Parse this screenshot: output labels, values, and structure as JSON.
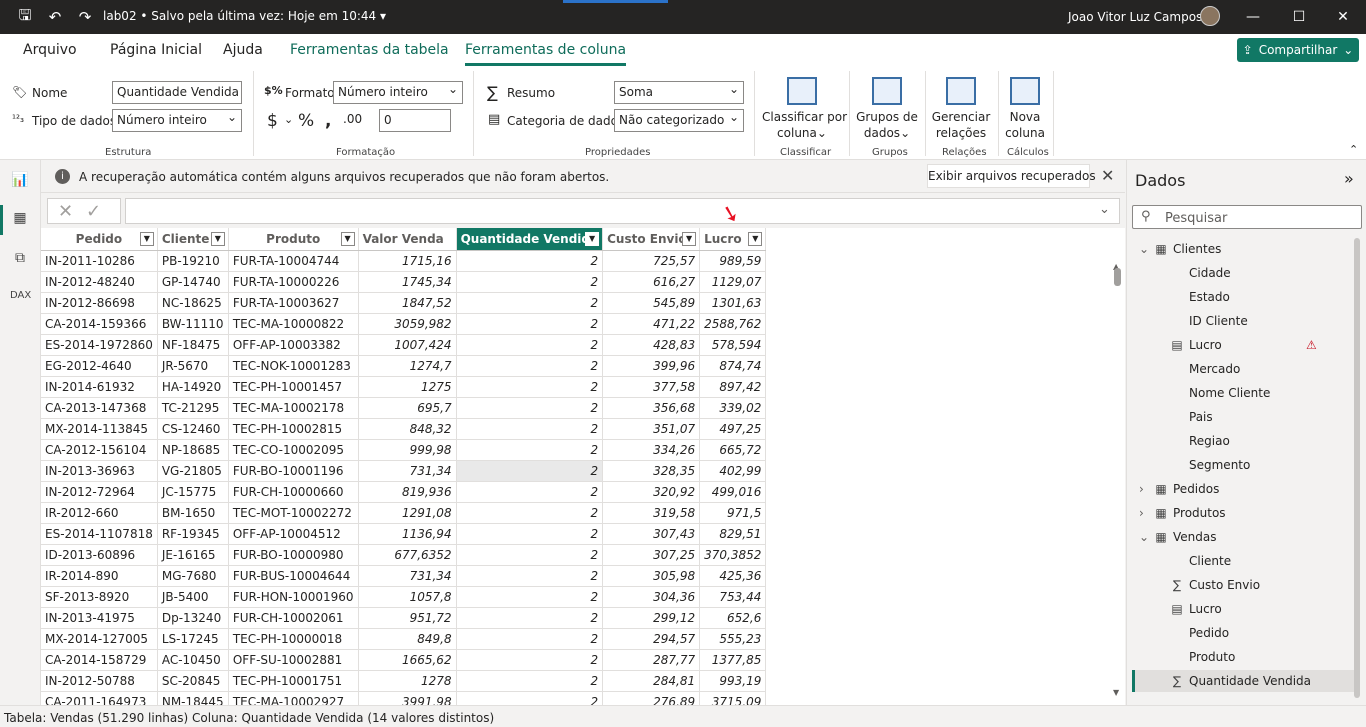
{
  "titlebar": {
    "title": "lab02 • Salvo pela última vez: Hoje em 10:44 ▾",
    "user": "Joao Vitor Luz Campos"
  },
  "tabs": {
    "arquivo": "Arquivo",
    "pagina_inicial": "Página Inicial",
    "ajuda": "Ajuda",
    "ferramentas_tabela": "Ferramentas da tabela",
    "ferramentas_coluna": "Ferramentas de coluna",
    "compartilhar": "Compartilhar"
  },
  "ribbon": {
    "nome_label": "Nome",
    "nome_value": "Quantidade Vendida",
    "tipo_label": "Tipo de dados",
    "tipo_value": "Número inteiro",
    "estrutura": "Estrutura",
    "formato_label": "Formato",
    "formato_value": "Número inteiro",
    "decimal_value": "0",
    "formatacao": "Formatação",
    "resumo_label": "Resumo",
    "resumo_value": "Soma",
    "categoria_label": "Categoria de dados",
    "categoria_value": "Não categorizado",
    "propriedades": "Propriedades",
    "classificar_btn": "Classificar por",
    "classificar_btn2": "coluna",
    "classificar": "Classificar",
    "grupos_btn": "Grupos de",
    "grupos_btn2": "dados",
    "grupos": "Grupos",
    "gerenciar_btn": "Gerenciar",
    "gerenciar_btn2": "relações",
    "relacoes": "Relações",
    "nova_btn": "Nova",
    "nova_btn2": "coluna",
    "calculos": "Cálculos"
  },
  "infobar": {
    "message": "A recuperação automática contém alguns arquivos recuperados que não foram abertos.",
    "button": "Exibir arquivos recuperados"
  },
  "table": {
    "columns": [
      "Pedido",
      "Cliente",
      "Produto",
      "Valor Venda",
      "Quantidade Vendida",
      "Custo Envio",
      "Lucro"
    ],
    "rows": [
      [
        "IN-2011-10286",
        "PB-19210",
        "FUR-TA-10004744",
        "1715,16",
        "2",
        "725,57",
        "989,59"
      ],
      [
        "IN-2012-48240",
        "GP-14740",
        "FUR-TA-10000226",
        "1745,34",
        "2",
        "616,27",
        "1129,07"
      ],
      [
        "IN-2012-86698",
        "NC-18625",
        "FUR-TA-10003627",
        "1847,52",
        "2",
        "545,89",
        "1301,63"
      ],
      [
        "CA-2014-159366",
        "BW-11110",
        "TEC-MA-10000822",
        "3059,982",
        "2",
        "471,22",
        "2588,762"
      ],
      [
        "ES-2014-1972860",
        "NF-18475",
        "OFF-AP-10003382",
        "1007,424",
        "2",
        "428,83",
        "578,594"
      ],
      [
        "EG-2012-4640",
        "JR-5670",
        "TEC-NOK-10001283",
        "1274,7",
        "2",
        "399,96",
        "874,74"
      ],
      [
        "IN-2014-61932",
        "HA-14920",
        "TEC-PH-10001457",
        "1275",
        "2",
        "377,58",
        "897,42"
      ],
      [
        "CA-2013-147368",
        "TC-21295",
        "TEC-MA-10002178",
        "695,7",
        "2",
        "356,68",
        "339,02"
      ],
      [
        "MX-2014-113845",
        "CS-12460",
        "TEC-PH-10002815",
        "848,32",
        "2",
        "351,07",
        "497,25"
      ],
      [
        "CA-2012-156104",
        "NP-18685",
        "TEC-CO-10002095",
        "999,98",
        "2",
        "334,26",
        "665,72"
      ],
      [
        "IN-2013-36963",
        "VG-21805",
        "FUR-BO-10001196",
        "731,34",
        "2",
        "328,35",
        "402,99"
      ],
      [
        "IN-2012-72964",
        "JC-15775",
        "FUR-CH-10000660",
        "819,936",
        "2",
        "320,92",
        "499,016"
      ],
      [
        "IR-2012-660",
        "BM-1650",
        "TEC-MOT-10002272",
        "1291,08",
        "2",
        "319,58",
        "971,5"
      ],
      [
        "ES-2014-1107818",
        "RF-19345",
        "OFF-AP-10004512",
        "1136,94",
        "2",
        "307,43",
        "829,51"
      ],
      [
        "ID-2013-60896",
        "JE-16165",
        "FUR-BO-10000980",
        "677,6352",
        "2",
        "307,25",
        "370,3852"
      ],
      [
        "IR-2014-890",
        "MG-7680",
        "FUR-BUS-10004644",
        "731,34",
        "2",
        "305,98",
        "425,36"
      ],
      [
        "SF-2013-8920",
        "JB-5400",
        "FUR-HON-10001960",
        "1057,8",
        "2",
        "304,36",
        "753,44"
      ],
      [
        "IN-2013-41975",
        "Dp-13240",
        "FUR-CH-10002061",
        "951,72",
        "2",
        "299,12",
        "652,6"
      ],
      [
        "MX-2014-127005",
        "LS-17245",
        "TEC-PH-10000018",
        "849,8",
        "2",
        "294,57",
        "555,23"
      ],
      [
        "CA-2014-158729",
        "AC-10450",
        "OFF-SU-10002881",
        "1665,62",
        "2",
        "287,77",
        "1377,85"
      ],
      [
        "IN-2012-50788",
        "SC-20845",
        "TEC-PH-10001751",
        "1278",
        "2",
        "284,81",
        "993,19"
      ],
      [
        "CA-2011-164973",
        "NM-18445",
        "TEC-MA-10002927",
        "3991,98",
        "2",
        "276,89",
        "3715,09"
      ]
    ]
  },
  "panel": {
    "title": "Dados",
    "search_placeholder": "Pesquisar",
    "tree": [
      {
        "label": "Clientes",
        "kind": "table",
        "expanded": true
      },
      {
        "label": "Cidade",
        "kind": "field"
      },
      {
        "label": "Estado",
        "kind": "field"
      },
      {
        "label": "ID Cliente",
        "kind": "field"
      },
      {
        "label": "Lucro",
        "kind": "calc",
        "warning": true
      },
      {
        "label": "Mercado",
        "kind": "field"
      },
      {
        "label": "Nome Cliente",
        "kind": "field"
      },
      {
        "label": "Pais",
        "kind": "field"
      },
      {
        "label": "Regiao",
        "kind": "field"
      },
      {
        "label": "Segmento",
        "kind": "field"
      },
      {
        "label": "Pedidos",
        "kind": "table",
        "expanded": false
      },
      {
        "label": "Produtos",
        "kind": "table",
        "expanded": false
      },
      {
        "label": "Vendas",
        "kind": "table",
        "expanded": true
      },
      {
        "label": "Cliente",
        "kind": "field"
      },
      {
        "label": "Custo Envio",
        "kind": "sum"
      },
      {
        "label": "Lucro",
        "kind": "calc"
      },
      {
        "label": "Pedido",
        "kind": "field"
      },
      {
        "label": "Produto",
        "kind": "field"
      },
      {
        "label": "Quantidade Vendida",
        "kind": "sum",
        "selected": true
      }
    ]
  },
  "statusbar": "Tabela: Vendas (51.290 linhas) Coluna: Quantidade Vendida (14 valores distintos)",
  "colors": {
    "accent": "#117865",
    "titlebar": "#252423",
    "warning": "#c50f1f"
  }
}
